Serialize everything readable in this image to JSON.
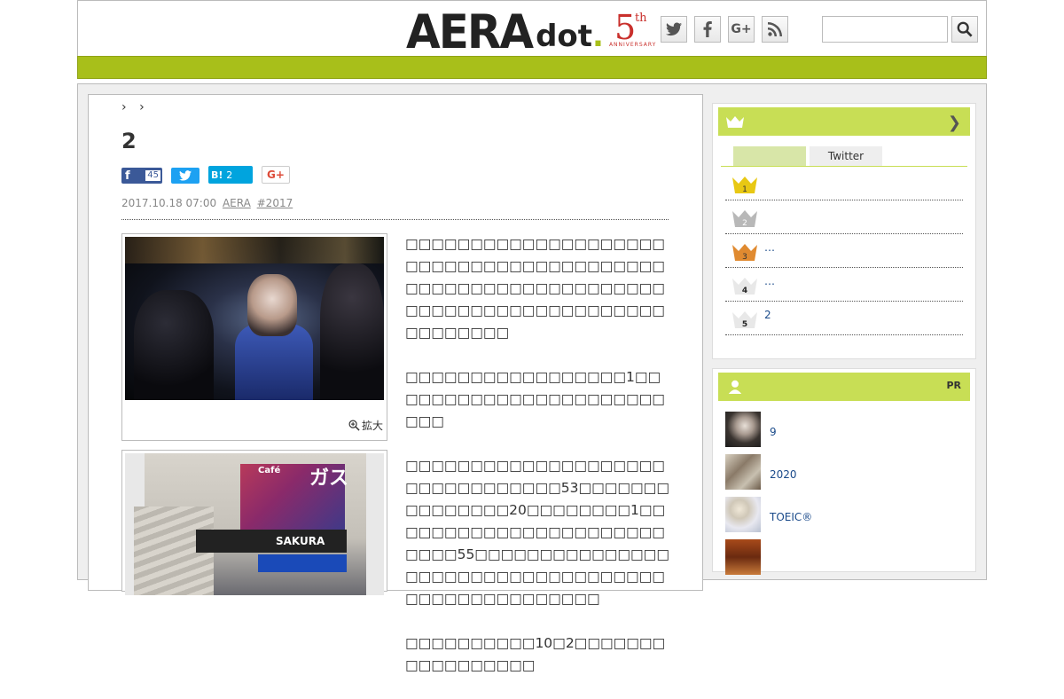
{
  "header": {
    "logo_main": "AERA",
    "logo_sub": "dot",
    "anniversary_number": "5",
    "anniversary_suffix": "th",
    "anniversary_text": "ANNIVERSARY",
    "search_placeholder": ""
  },
  "breadcrumb": {
    "sep1": "›",
    "sep2": "›"
  },
  "article": {
    "title": "2",
    "share": {
      "facebook_count": "45",
      "hatena_label": "B!",
      "hatena_count": "2",
      "gplus_label": "G+"
    },
    "date": "2017.10.18 07:00",
    "source": "AERA",
    "tag": "#2017",
    "zoom_label": "拡大",
    "paragraphs": [
      "□□□□□□□□□□□□□□□□□□□□□□□□□□□□□□□□□□□□□□□□□□□□□□□□□□□□□□□□□□□□□□□□□□□□□□□□□□□□□□□□□□□□□□□□",
      "□□□□□□□□□□□□□□□□□1□□□□□□□□□□□□□□□□□□□□□□□□□",
      "□□□□□□□□□□□□□□□□□□□□□□□□□□□□□□□□53□□□□□□□□□□□□□□□20□□□□□□□□1□□□□□□□□□□□□□□□□□□□□□□□□□□55□□□□□□□□□□□□□□□□□□□□□□□□□□□□□□□□□□□□□□□□□□□□□□□□□□",
      "□□□□□□□□□□10□2□□□□□□□□□□□□□□□□□"
    ]
  },
  "sidebar": {
    "ranking": {
      "tabs": [
        "",
        "Twitter"
      ],
      "items": [
        {
          "rank": "1",
          "text": ""
        },
        {
          "rank": "2",
          "text": ""
        },
        {
          "rank": "3",
          "text": "…"
        },
        {
          "rank": "4",
          "text": "…"
        },
        {
          "rank": "5",
          "text": "2"
        }
      ]
    },
    "people": {
      "pr_label": "PR",
      "items": [
        {
          "text": "9"
        },
        {
          "text": "2020"
        },
        {
          "text": "TOEIC®"
        },
        {
          "text": ""
        }
      ]
    }
  }
}
